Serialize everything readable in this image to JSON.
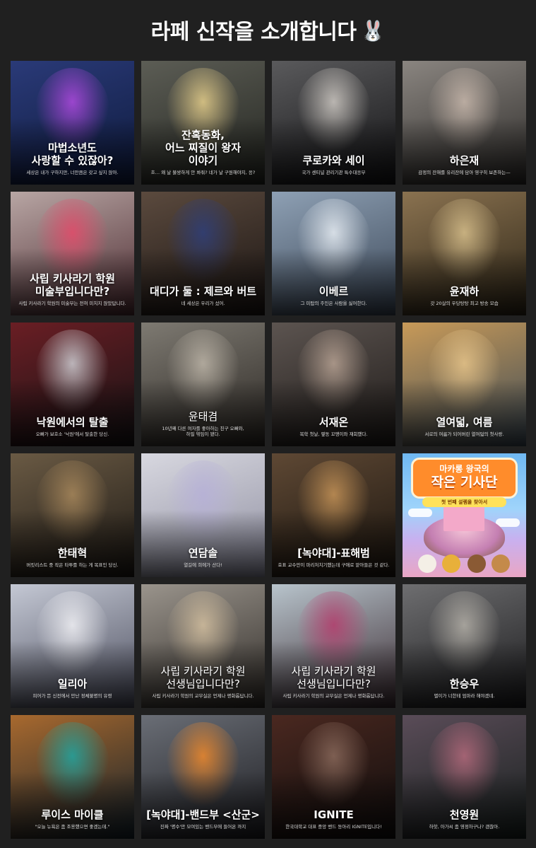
{
  "header": {
    "title": "라페 신작을 소개합니다",
    "title_icon": "rabbit-icon",
    "title_glyph": "🐰"
  },
  "cards": [
    {
      "title": "마법소년도\n사랑할 수 있잖아?",
      "subtitle": "세상은 내가 구하지만, 너만큼은 갖고 싶지 않아.",
      "colors": [
        "#2a3a78",
        "#0e1a3c",
        "#b04ae0"
      ]
    },
    {
      "title": "잔혹동화,\n어느 찌질이 왕자\n이야기",
      "subtitle": "흐… 왜 날 불쌍하게 안 봐줘? 네가 날 구원해야지, 응?",
      "colors": [
        "#5c5d55",
        "#22241f",
        "#e7d08c"
      ]
    },
    {
      "title": "쿠로카와 세이",
      "subtitle": "국가 센티널 관리기관 특수대응부",
      "colors": [
        "#5a5a5c",
        "#121214",
        "#cfcac4"
      ]
    },
    {
      "title": "하은재",
      "subtitle": "감정의 잔해를 유리잔에 담아 영구히 보존하는—",
      "colors": [
        "#8a8580",
        "#2c2a28",
        "#c8b8ac"
      ]
    },
    {
      "title": "사립 키사라기 학원\n미술부입니다만?",
      "subtitle": "사립 키사라기 학원의 미술부는 전혀 미치지 않았답니다.",
      "colors": [
        "#b8a6a4",
        "#4c2a30",
        "#e44a6a"
      ]
    },
    {
      "title": "대디가 둘 : 제르와 버트",
      "subtitle": "네 세상은 우리가 섰어.",
      "colors": [
        "#5b4a3e",
        "#1a1412",
        "#2f3f7a"
      ]
    },
    {
      "title": "이베르",
      "subtitle": "그 미탑의 주인은 사람을 싫어한다.",
      "colors": [
        "#8ea0b4",
        "#3a4656",
        "#e8eef4"
      ]
    },
    {
      "title": "윤재하",
      "subtitle": "갓 20살의 우당탕탕 최고 방송 모습",
      "colors": [
        "#8a7250",
        "#2c2416",
        "#d8c08c"
      ]
    },
    {
      "title": "낙원에서의 탈출",
      "subtitle": "오빠가 보호소 '낙원'에서 탈출한 당신.",
      "colors": [
        "#6a1e24",
        "#141214",
        "#cfcfd4"
      ]
    },
    {
      "title": "윤태겸",
      "subtitle": "10년째 다른 여자를 좋아하는 친구 오빠와,\n하필 엮임이 됐다.",
      "colors": [
        "#7e7a72",
        "#2a2622",
        "#bdb5a8"
      ],
      "thin": true
    },
    {
      "title": "서재온",
      "subtitle": "복학 첫날, 옆동 꼬맹이와 재회했다.",
      "colors": [
        "#5c5450",
        "#1e1a18",
        "#b8a394"
      ]
    },
    {
      "title": "열여덟, 여름",
      "subtitle": "서로의 여름가 되어버린 열여덟의 첫사랑.",
      "colors": [
        "#c89a58",
        "#3c4a56",
        "#e6c48a"
      ]
    },
    {
      "title": "한태혁",
      "subtitle": "버킷리스트 중 작은 타투를 하는 게 목표인 당신.",
      "colors": [
        "#6a5a44",
        "#1c1814",
        "#a8885c"
      ]
    },
    {
      "title": "연담솔",
      "subtitle": "열길에 희에가 산다!",
      "colors": [
        "#d8d8e0",
        "#8e8ea0",
        "#b6b0d8"
      ]
    },
    {
      "title": "[녹야대]-표해범",
      "subtitle": "효표 교수만이 마리처치기했는데 구애로 맡아들은 것 같다.",
      "colors": [
        "#5e4834",
        "#1a140e",
        "#c69458"
      ]
    },
    {
      "poster": true,
      "line1": "마카롱 왕국의",
      "line2": "작은 기사단",
      "ribbon": "첫 번째 설렘을 찾아서",
      "colors": [
        "#6fb8f2",
        "#e9a6c4",
        "#ffffff"
      ]
    },
    {
      "title": "일리아",
      "subtitle": "피어가 뜬 신전에서 만난 정체불명의 유령",
      "colors": [
        "#c4c8d4",
        "#4a4c5c",
        "#f0f0f4"
      ]
    },
    {
      "title": "사립 키사라기 학원\n선생님입니다만?",
      "subtitle": "사립 키사라기 학원의 교무실은 언제나 평화롭답니다.",
      "colors": [
        "#9a948c",
        "#2e2a26",
        "#d4c0a0"
      ],
      "thin": true
    },
    {
      "title": "사립 키사라기 학원\n선생님입니다만?",
      "subtitle": "사립 키사라기 학원의 교무실은 언제나 평화롭답니다.",
      "colors": [
        "#b8c4cc",
        "#3a2a30",
        "#b43c6c"
      ],
      "thin": true
    },
    {
      "title": "한승우",
      "subtitle": "별이가 너한테 엄마라 해야겠네.",
      "colors": [
        "#6e6e70",
        "#1a1a1c",
        "#b4b0a8"
      ]
    },
    {
      "title": "루이스 마이클",
      "subtitle": "\"오늘 뉴욕은 좀 조용했으면 좋겠는데.\"",
      "colors": [
        "#a8692e",
        "#12202a",
        "#1fa6a2"
      ]
    },
    {
      "title": "[녹야대]-밴드부 <산군>",
      "subtitle": "진짜 '명수'만 모여있는 밴드부에 들어온 까지",
      "colors": [
        "#6a6e76",
        "#1c1c20",
        "#f08a2c"
      ]
    },
    {
      "title": "IGNITE",
      "subtitle": "한국대학교 대표 중앙 밴드 동아리 IGNITE입니다!",
      "colors": [
        "#4a2820",
        "#0e0c0c",
        "#8a6a5c"
      ]
    },
    {
      "title": "천영원",
      "subtitle": "하핫, 아가씨 좀 영정하구나? 괜찮아.",
      "colors": [
        "#5a4c58",
        "#18201e",
        "#b46a7c"
      ]
    }
  ]
}
